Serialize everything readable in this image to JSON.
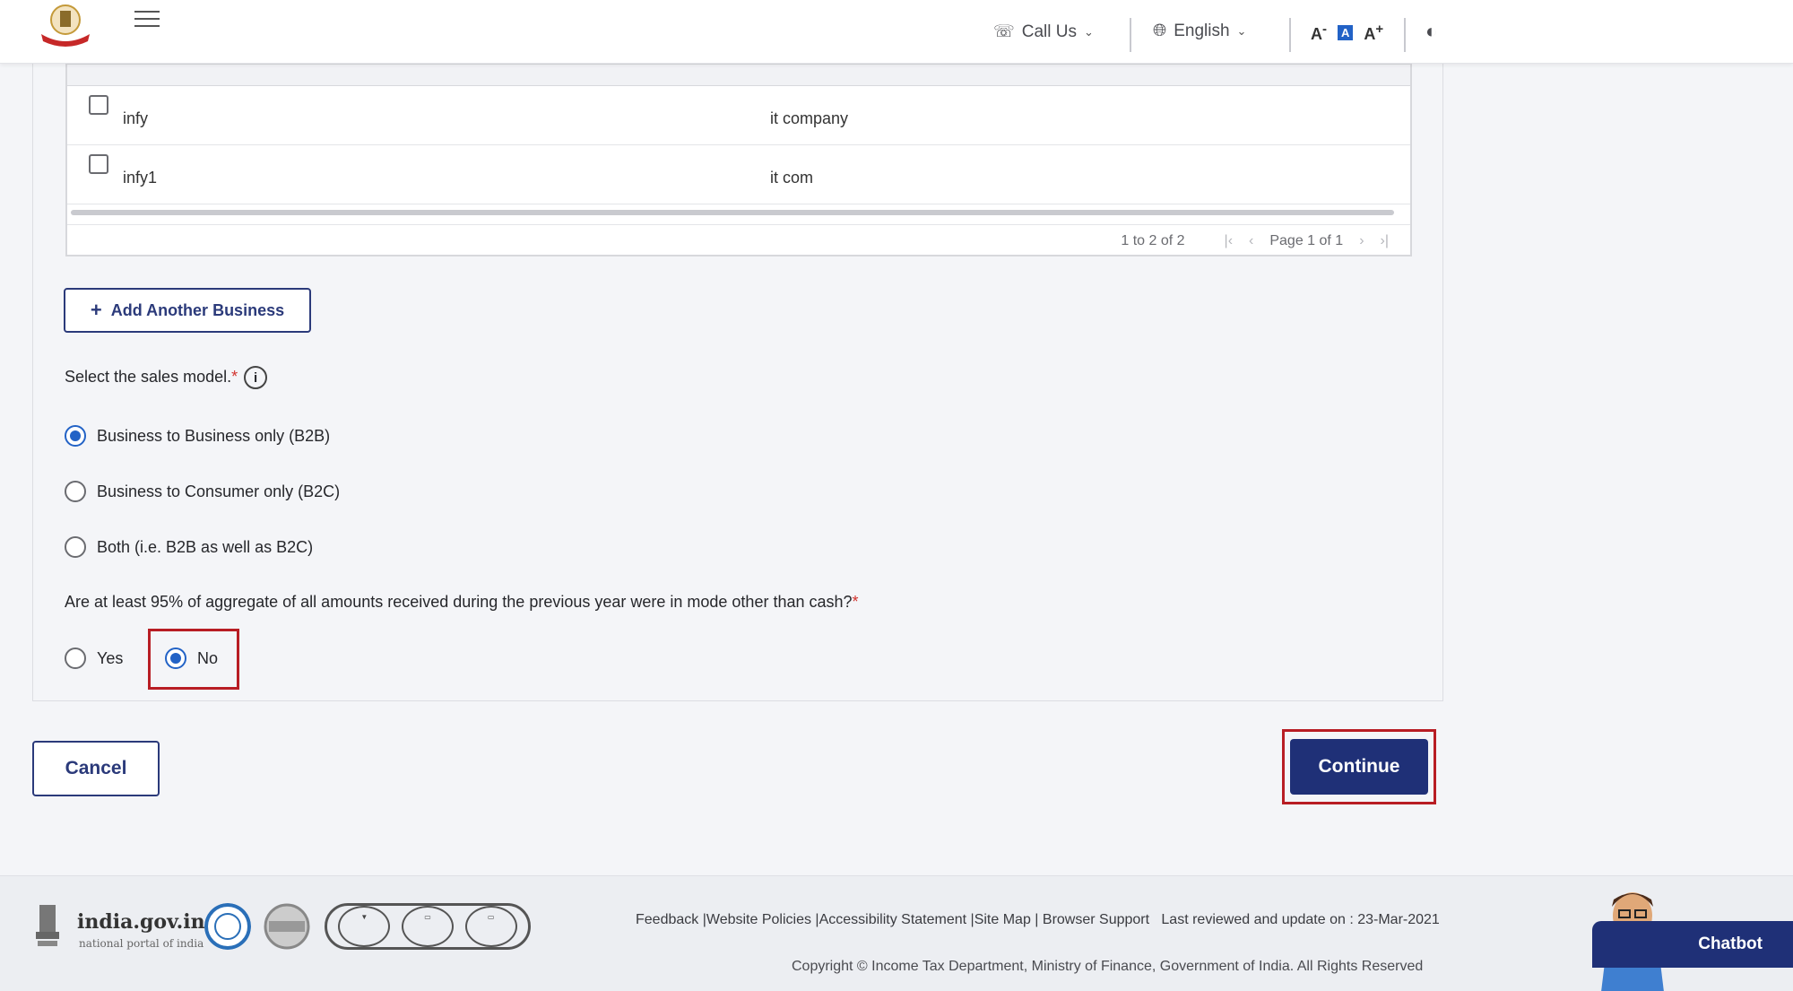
{
  "header": {
    "call_us": "Call Us",
    "language": "English",
    "font_decrease": "A",
    "font_default": "A",
    "font_increase": "A",
    "font_decrease_sup": "-",
    "font_increase_sup": "+"
  },
  "table": {
    "rows": [
      {
        "name": "infy",
        "description": "it company"
      },
      {
        "name": "infy1",
        "description": "it com"
      }
    ],
    "range": "1 to 2 of 2",
    "page": "Page 1 of 1"
  },
  "add_business": {
    "label": "Add Another Business"
  },
  "sales_model": {
    "question": "Select the sales model.",
    "required_mark": "*",
    "options": [
      {
        "label": "Business to Business only (B2B)",
        "selected": true
      },
      {
        "label": "Business to Consumer only (B2C)",
        "selected": false
      },
      {
        "label": "Both (i.e. B2B as well as B2C)",
        "selected": false
      }
    ]
  },
  "cash_question": {
    "question": "Are at least 95% of aggregate of all amounts received during the previous year were in mode other than cash?",
    "required_mark": "*",
    "options": [
      {
        "label": "Yes",
        "selected": false
      },
      {
        "label": "No",
        "selected": true
      }
    ]
  },
  "actions": {
    "cancel": "Cancel",
    "continue": "Continue"
  },
  "footer": {
    "portal_title": "india.gov.in",
    "portal_subtitle": "national portal of india",
    "links": [
      "Feedback",
      "Website Policies",
      "Accessibility Statement",
      "Site Map",
      "Browser Support"
    ],
    "last_reviewed": "Last reviewed and update on : 23-Mar-2021",
    "copyright": "Copyright © Income Tax Department, Ministry of Finance, Government of India. All Rights Reserved",
    "chatbot": "Chatbot"
  },
  "colors": {
    "primary": "#1f3077",
    "accent": "#2262c6",
    "highlight": "#b81d24"
  }
}
